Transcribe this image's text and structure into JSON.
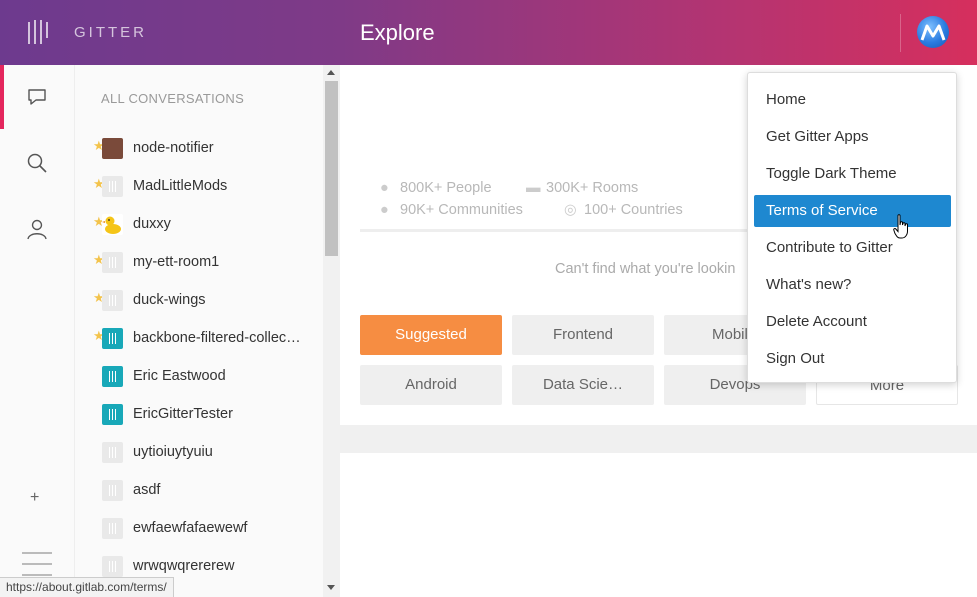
{
  "header": {
    "logo_text": "GITTER",
    "title": "Explore",
    "gradient": [
      "#6d3a8e",
      "#d62f5d"
    ]
  },
  "rail": {
    "items": [
      "chat-icon",
      "search-icon",
      "person-icon"
    ],
    "add_label": "+"
  },
  "conversations": {
    "heading": "ALL CONVERSATIONS",
    "rooms": [
      {
        "name": "node-notifier",
        "favourite": true
      },
      {
        "name": "MadLittleMods",
        "favourite": true
      },
      {
        "name": "duxxy",
        "favourite": true
      },
      {
        "name": "my-ett-room1",
        "favourite": true
      },
      {
        "name": "duck-wings",
        "favourite": true
      },
      {
        "name": "backbone-filtered-collec…",
        "favourite": true
      },
      {
        "name": "Eric Eastwood",
        "favourite": false
      },
      {
        "name": "EricGitterTester",
        "favourite": false
      },
      {
        "name": "uytioiuytyuiu",
        "favourite": false
      },
      {
        "name": "asdf",
        "favourite": false
      },
      {
        "name": "ewfaewfafaewewf",
        "favourite": false
      },
      {
        "name": "wrwqwqrererew",
        "favourite": false
      }
    ]
  },
  "explore": {
    "stats": {
      "people": "800K+ People",
      "rooms": "300K+ Rooms",
      "communities": "90K+ Communities",
      "countries": "100+ Countries"
    },
    "cant_find": "Can't find what you're lookin",
    "tags": [
      "Suggested",
      "Frontend",
      "Mobil",
      "Android",
      "Data Scie…",
      "Devops",
      "More"
    ],
    "accent": "#f68d42"
  },
  "menu": {
    "items": [
      "Home",
      "Get Gitter Apps",
      "Toggle Dark Theme",
      "Terms of Service",
      "Contribute to Gitter",
      "What's new?",
      "Delete Account",
      "Sign Out"
    ],
    "active_index": 3,
    "active_color": "#1e88d0"
  },
  "statusbar": {
    "url": "https://about.gitlab.com/terms/"
  }
}
